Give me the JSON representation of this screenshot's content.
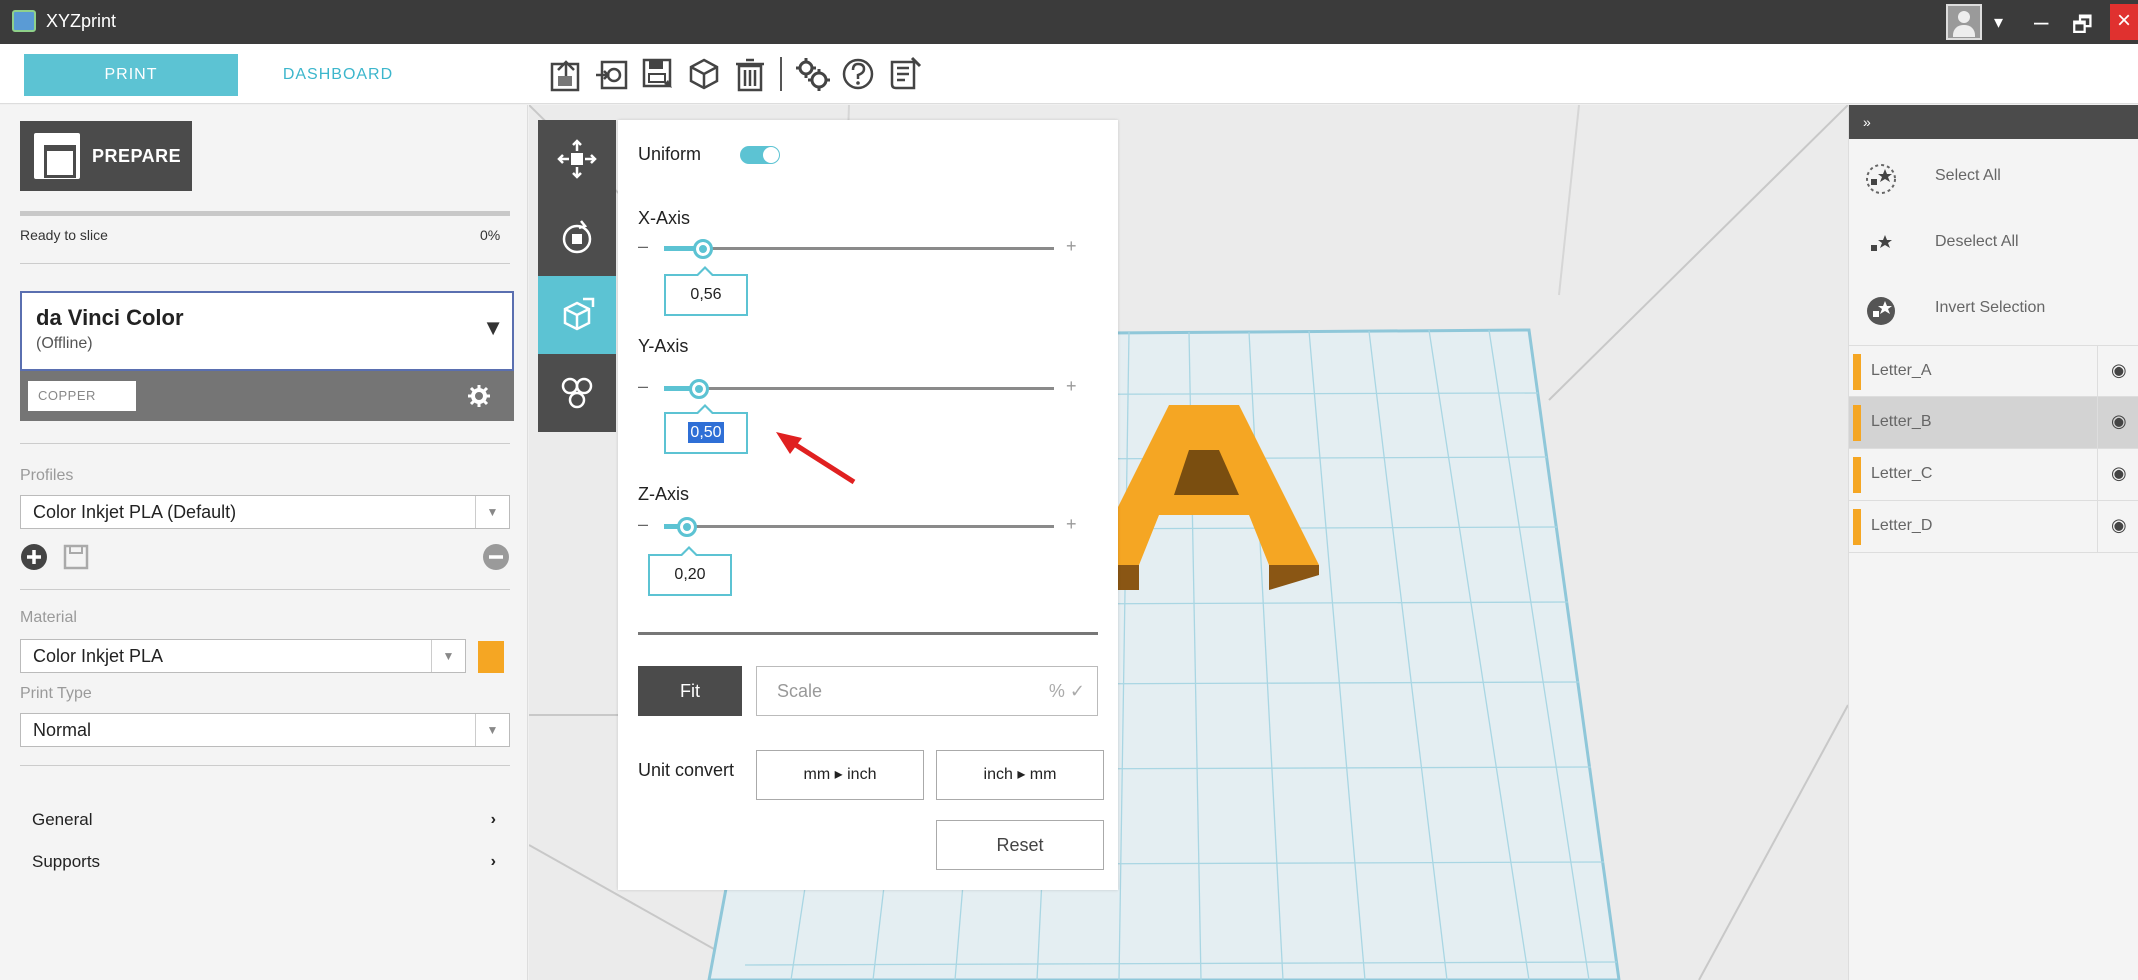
{
  "window": {
    "title": "XYZprint"
  },
  "tabs": {
    "print": "PRINT",
    "dashboard": "DASHBOARD"
  },
  "toolbar": {
    "icons": [
      "import-icon",
      "load-icon",
      "save-icon",
      "object-icon",
      "delete-icon",
      "settings-icon",
      "help-icon",
      "tutorial-icon"
    ]
  },
  "left": {
    "prepare_label": "PREPARE",
    "status": "Ready to slice",
    "progress": "0%",
    "progress_value": 0,
    "printer": {
      "name": "da Vinci Color",
      "status": "(Offline)",
      "material_tag": "COPPER"
    },
    "profiles_label": "Profiles",
    "profile_value": "Color Inkjet PLA (Default)",
    "material_label": "Material",
    "material_value": "Color Inkjet PLA",
    "material_color": "#f5a623",
    "print_type_label": "Print Type",
    "print_type_value": "Normal",
    "menu": [
      {
        "label": "General"
      },
      {
        "label": "Supports"
      }
    ]
  },
  "scale_panel": {
    "uniform_label": "Uniform",
    "uniform_on": true,
    "x_label": "X-Axis",
    "x_value": "0,56",
    "x_slider_fraction": 0.1,
    "y_label": "Y-Axis",
    "y_value": "0,50",
    "y_slider_fraction": 0.09,
    "z_label": "Z-Axis",
    "z_value": "0,20",
    "z_slider_fraction": 0.06,
    "fit_label": "Fit",
    "scale_placeholder": "Scale",
    "scale_suffix": "% ✓",
    "unit_convert_label": "Unit convert",
    "mm_to_inch": "mm ▸ inch",
    "inch_to_mm": "inch ▸ mm",
    "reset_label": "Reset"
  },
  "right": {
    "header_glyph": "»",
    "actions": [
      {
        "label": "Select All"
      },
      {
        "label": "Deselect All"
      },
      {
        "label": "Invert Selection"
      }
    ],
    "objects": [
      {
        "label": "Letter_A"
      },
      {
        "label": "Letter_B"
      },
      {
        "label": "Letter_C"
      },
      {
        "label": "Letter_D"
      }
    ]
  },
  "colors": {
    "accent": "#5cc3d3",
    "object": "#f5a623",
    "dark": "#4b4b4b"
  }
}
